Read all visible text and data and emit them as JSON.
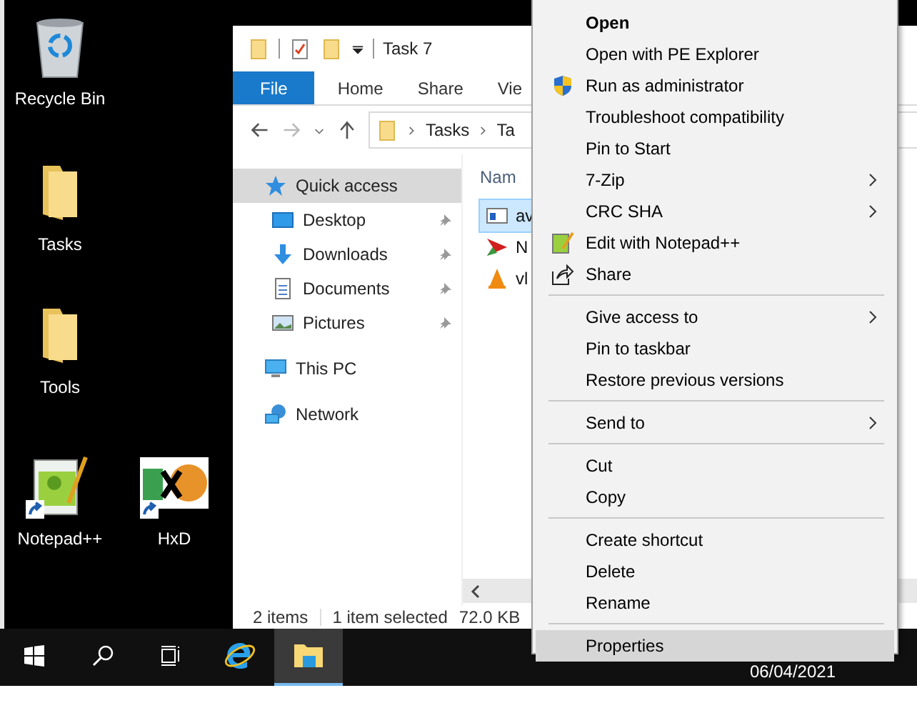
{
  "desktop_icons": [
    {
      "label": "Recycle Bin",
      "kind": "recycle",
      "shortcut": false
    },
    {
      "label": "Tasks",
      "kind": "folder",
      "shortcut": false
    },
    {
      "label": "Tools",
      "kind": "folder",
      "shortcut": false
    },
    {
      "label": "Notepad++",
      "kind": "notepad",
      "shortcut": true
    },
    {
      "label": "HxD",
      "kind": "hxd",
      "shortcut": true
    }
  ],
  "explorer": {
    "title": "Task 7",
    "ribbon_tabs": [
      {
        "label": "File",
        "selected": true
      },
      {
        "label": "Home",
        "selected": false
      },
      {
        "label": "Share",
        "selected": false
      },
      {
        "label": "Vie",
        "selected": false
      }
    ],
    "breadcrumb": [
      "Tasks",
      "Ta"
    ],
    "nav": [
      {
        "label": "Quick access",
        "kind": "star",
        "selected": true,
        "pinned": false,
        "child": false
      },
      {
        "label": "Desktop",
        "kind": "desktop",
        "selected": false,
        "pinned": true,
        "child": true
      },
      {
        "label": "Downloads",
        "kind": "download",
        "selected": false,
        "pinned": true,
        "child": true
      },
      {
        "label": "Documents",
        "kind": "document",
        "selected": false,
        "pinned": true,
        "child": true
      },
      {
        "label": "Pictures",
        "kind": "picture",
        "selected": false,
        "pinned": true,
        "child": true
      },
      {
        "label": "This PC",
        "kind": "pc",
        "selected": false,
        "pinned": false,
        "child": false
      },
      {
        "label": "Network",
        "kind": "network",
        "selected": false,
        "pinned": false,
        "child": false
      }
    ],
    "column_header": "Nam",
    "files": [
      {
        "name": "av",
        "kind": "window",
        "selected": true
      },
      {
        "name": "N",
        "kind": "arrow",
        "selected": false
      },
      {
        "name": "vl",
        "kind": "cone",
        "selected": false
      }
    ],
    "status": [
      "2 items",
      "1 item selected",
      "72.0 KB"
    ]
  },
  "context_menu": {
    "groups": [
      [
        {
          "label": "Open",
          "bold": true,
          "selected": false
        },
        {
          "label": "Open with PE Explorer",
          "selected": false
        },
        {
          "label": "Run as administrator",
          "kind": "shield",
          "selected": false
        },
        {
          "label": "Troubleshoot compatibility",
          "selected": false
        },
        {
          "label": "Pin to Start",
          "selected": false
        },
        {
          "label": "7-Zip",
          "submenu": true,
          "selected": false
        },
        {
          "label": "CRC SHA",
          "submenu": true,
          "selected": false
        },
        {
          "label": "Edit with Notepad++",
          "kind": "notepad",
          "selected": false
        },
        {
          "label": "Share",
          "kind": "share",
          "selected": false
        }
      ],
      [
        {
          "label": "Give access to",
          "submenu": true,
          "selected": false
        },
        {
          "label": "Pin to taskbar",
          "selected": false
        },
        {
          "label": "Restore previous versions",
          "selected": false
        }
      ],
      [
        {
          "label": "Send to",
          "submenu": true,
          "selected": false
        }
      ],
      [
        {
          "label": "Cut",
          "selected": false
        },
        {
          "label": "Copy",
          "selected": false
        }
      ],
      [
        {
          "label": "Create shortcut",
          "selected": false
        },
        {
          "label": "Delete",
          "selected": false
        },
        {
          "label": "Rename",
          "selected": false
        }
      ],
      [
        {
          "label": "Properties",
          "selected": true
        }
      ]
    ]
  },
  "taskbar": {
    "apps": [
      {
        "kind": "start",
        "active": false
      },
      {
        "kind": "search",
        "active": false
      },
      {
        "kind": "taskview",
        "active": false
      },
      {
        "kind": "ie",
        "active": false
      },
      {
        "kind": "explorer",
        "active": true
      }
    ],
    "date": "06/04/2021"
  }
}
